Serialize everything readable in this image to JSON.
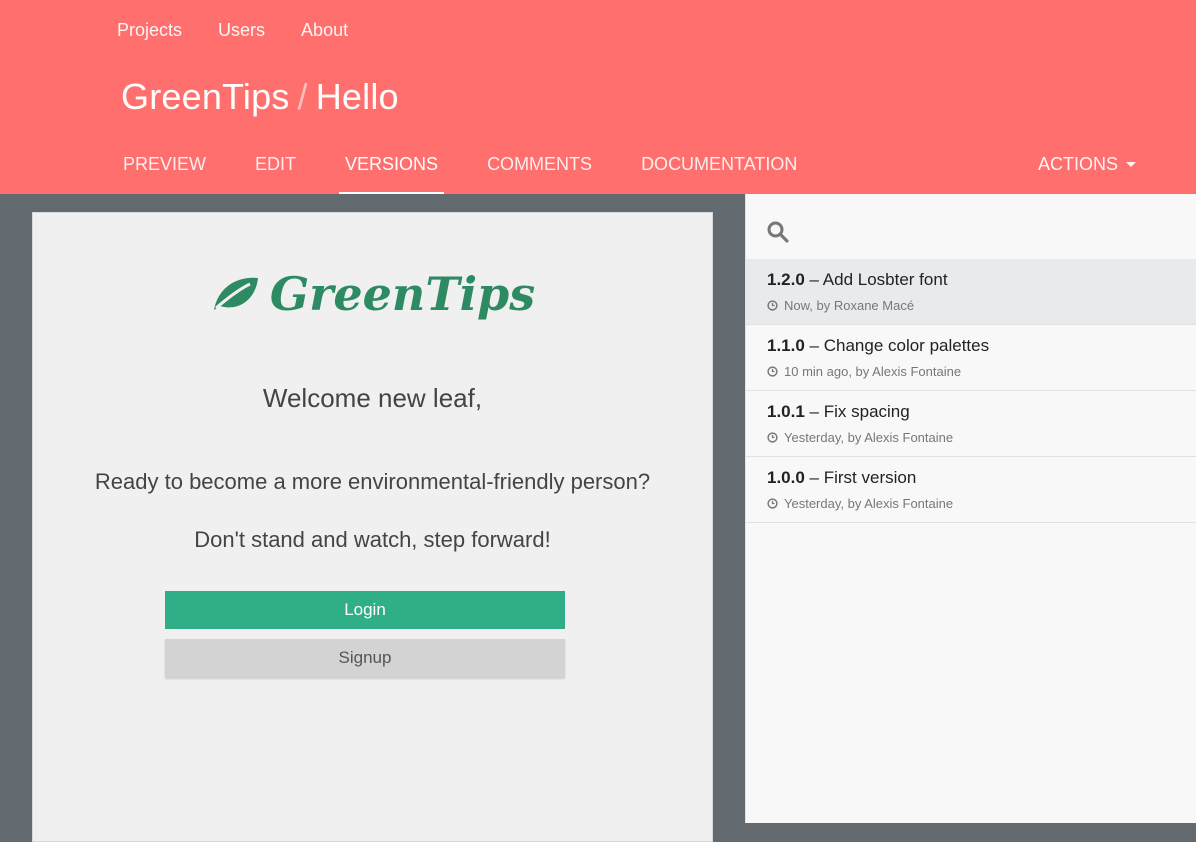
{
  "topnav": {
    "items": [
      "Projects",
      "Users",
      "About"
    ]
  },
  "breadcrumb": {
    "project": "GreenTips",
    "separator": "/",
    "page": "Hello"
  },
  "tabs": {
    "preview": "PREVIEW",
    "edit": "EDIT",
    "versions": "VERSIONS",
    "comments": "COMMENTS",
    "documentation": "DOCUMENTATION",
    "active": "VERSIONS"
  },
  "actions": {
    "label": "ACTIONS"
  },
  "preview": {
    "logo_text": "GreenTips",
    "welcome": "Welcome new leaf,",
    "line1": "Ready to become a more environmental-friendly person?",
    "line2": "Don't stand and watch, step forward!",
    "login": "Login",
    "signup": "Signup"
  },
  "versions": [
    {
      "number": "1.2.0",
      "desc": "– Add Losbter font",
      "meta": "Now, by Roxane Macé",
      "active": true
    },
    {
      "number": "1.1.0",
      "desc": "– Change color palettes",
      "meta": "10 min ago, by Alexis Fontaine",
      "active": false
    },
    {
      "number": "1.0.1",
      "desc": "– Fix spacing",
      "meta": "Yesterday, by Alexis Fontaine",
      "active": false
    },
    {
      "number": "1.0.0",
      "desc": "– First version",
      "meta": " Yesterday, by Alexis Fontaine",
      "active": false
    }
  ],
  "colors": {
    "header": "#ff6f6d",
    "brand_green": "#2e8a63",
    "login_button": "#2fae87",
    "preview_bg": "#626a6f",
    "active_version_bg": "#e7ebee"
  },
  "icons": {
    "search": "search-icon",
    "clock": "clock-icon",
    "leaf": "leaf-icon",
    "caret": "caret-down-icon"
  }
}
